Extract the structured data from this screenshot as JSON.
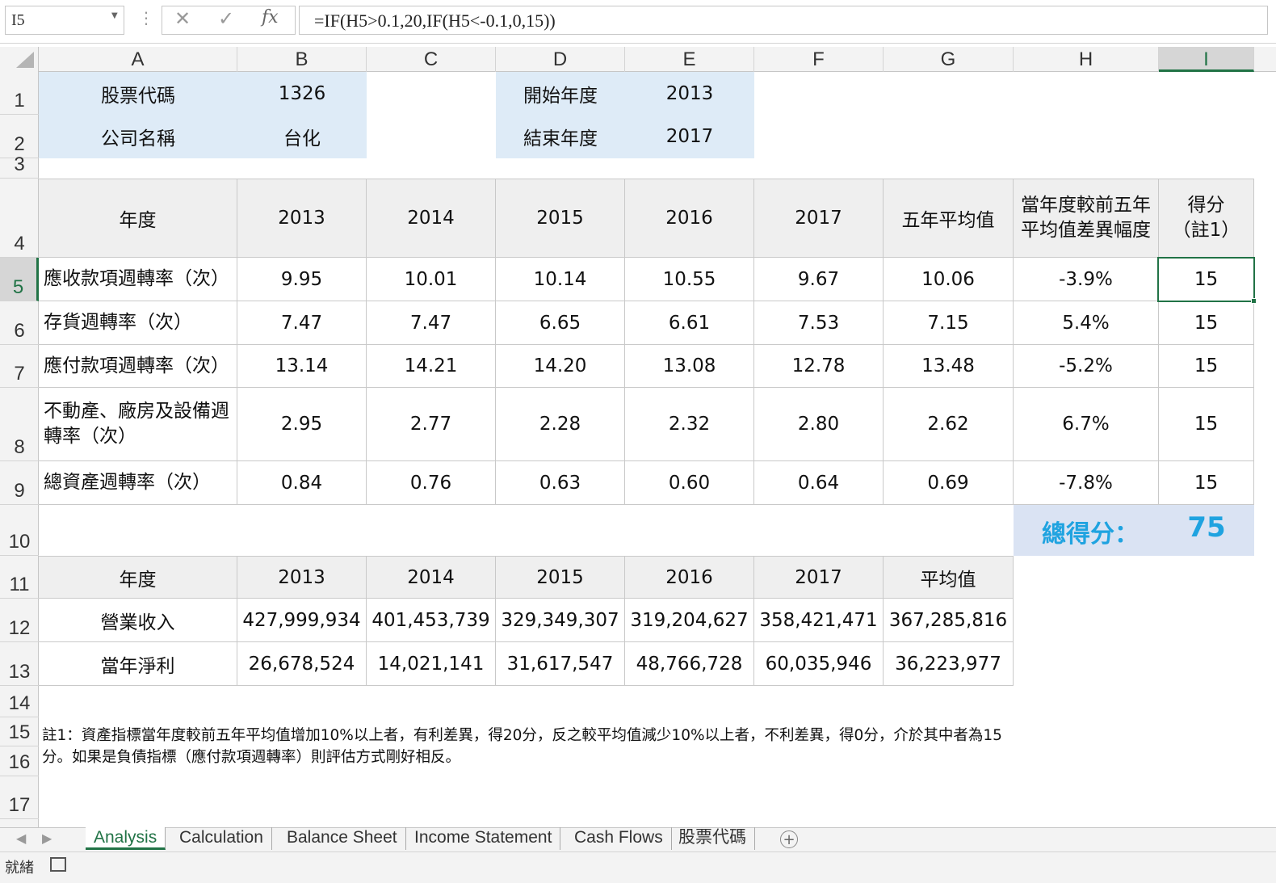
{
  "formula_bar": {
    "name_box": "I5",
    "formula": "=IF(H5>0.1,20,IF(H5<-0.1,0,15))"
  },
  "columns": [
    "A",
    "B",
    "C",
    "D",
    "E",
    "F",
    "G",
    "H",
    "I"
  ],
  "rows": [
    "1",
    "2",
    "3",
    "4",
    "5",
    "6",
    "7",
    "8",
    "9",
    "10",
    "11",
    "12",
    "13",
    "14",
    "15",
    "16",
    "17"
  ],
  "info": {
    "stock_code_label": "股票代碼",
    "stock_code": "1326",
    "company_label": "公司名稱",
    "company": "台化",
    "start_label": "開始年度",
    "start_year": "2013",
    "end_label": "結束年度",
    "end_year": "2017"
  },
  "turnover_table": {
    "headers": [
      "年度",
      "2013",
      "2014",
      "2015",
      "2016",
      "2017",
      "五年平均值",
      "當年度較前五年平均值差異幅度",
      "得分（註1）"
    ],
    "rows": [
      [
        "應收款項週轉率（次）",
        "9.95",
        "10.01",
        "10.14",
        "10.55",
        "9.67",
        "10.06",
        "-3.9%",
        "15"
      ],
      [
        "存貨週轉率（次）",
        "7.47",
        "7.47",
        "6.65",
        "6.61",
        "7.53",
        "7.15",
        "5.4%",
        "15"
      ],
      [
        "應付款項週轉率（次）",
        "13.14",
        "14.21",
        "14.20",
        "13.08",
        "12.78",
        "13.48",
        "-5.2%",
        "15"
      ],
      [
        "不動產、廠房及設備週轉率（次）",
        "2.95",
        "2.77",
        "2.28",
        "2.32",
        "2.80",
        "2.62",
        "6.7%",
        "15"
      ],
      [
        "總資產週轉率（次）",
        "0.84",
        "0.76",
        "0.63",
        "0.60",
        "0.64",
        "0.69",
        "-7.8%",
        "15"
      ]
    ]
  },
  "total": {
    "label": "總得分：",
    "value": "75",
    "color": "#1fa3e0",
    "bg": "#dae3f3"
  },
  "income_table": {
    "headers": [
      "年度",
      "2013",
      "2014",
      "2015",
      "2016",
      "2017",
      "平均值"
    ],
    "rows": [
      [
        "營業收入",
        "427,999,934",
        "401,453,739",
        "329,349,307",
        "319,204,627",
        "358,421,471",
        "367,285,816"
      ],
      [
        "當年淨利",
        "26,678,524",
        "14,021,141",
        "31,617,547",
        "48,766,728",
        "60,035,946",
        "36,223,977"
      ]
    ]
  },
  "note": "註1：資產指標當年度較前五年平均值增加10%以上者，有利差異，得20分，反之較平均值減少10%以上者，不利差異，得0分，介於其中者為15分。如果是負債指標（應付款項週轉率）則評估方式剛好相反。",
  "sheet_tabs": [
    "Analysis",
    "Calculation",
    "Balance Sheet",
    "Income Statement",
    "Cash Flows",
    "股票代碼"
  ],
  "status": "就緒"
}
